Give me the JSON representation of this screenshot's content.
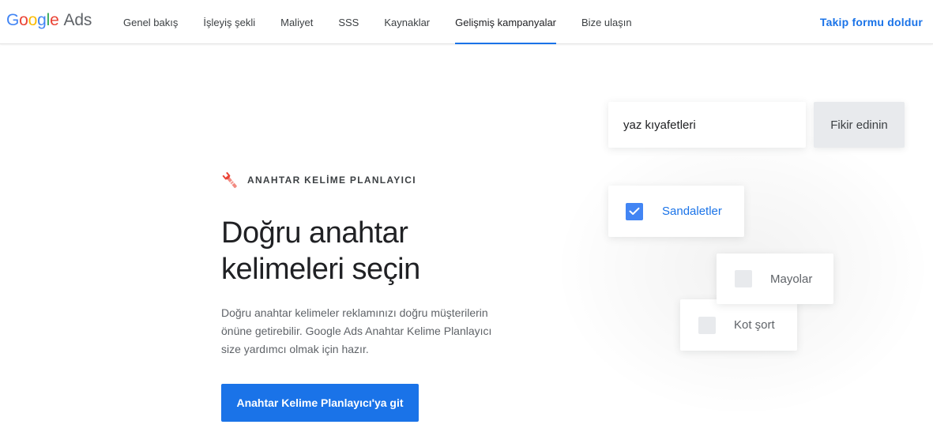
{
  "header": {
    "logo": {
      "word": [
        "G",
        "o",
        "o",
        "g",
        "l",
        "e"
      ],
      "product": "Ads"
    },
    "nav": [
      {
        "label": "Genel bakış"
      },
      {
        "label": "İşleyiş şekli"
      },
      {
        "label": "Maliyet"
      },
      {
        "label": "SSS"
      },
      {
        "label": "Kaynaklar"
      },
      {
        "label": "Gelişmiş kampanyalar",
        "active": true
      },
      {
        "label": "Bize ulaşın"
      }
    ],
    "cta_label": "Takip formu doldur"
  },
  "hero": {
    "eyebrow_icon": "wrench-icon",
    "eyebrow": "ANAHTAR KELİME PLANLAYICI",
    "title": "Doğru anahtar kelimeleri seçin",
    "description": "Doğru anahtar kelimeler reklamınızı doğru müşterilerin önüne getirebilir. Google Ads Anahtar Kelime Planlayıcı size yardımcı olmak için hazır.",
    "button_label": "Anahtar Kelime Planlayıcı'ya git"
  },
  "illustration": {
    "search_value": "yaz kıyafetleri",
    "idea_button": "Fikir edinin",
    "keywords": [
      {
        "label": "Sandaletler",
        "checked": true
      },
      {
        "label": "Mayolar",
        "checked": false
      },
      {
        "label": "Kot şort",
        "checked": false
      }
    ]
  },
  "colors": {
    "accent": "#1a73e8",
    "checkbox_checked": "#4285f4",
    "checkbox_unchecked": "#e8eaed",
    "idea_button_bg": "#e8eaed"
  }
}
